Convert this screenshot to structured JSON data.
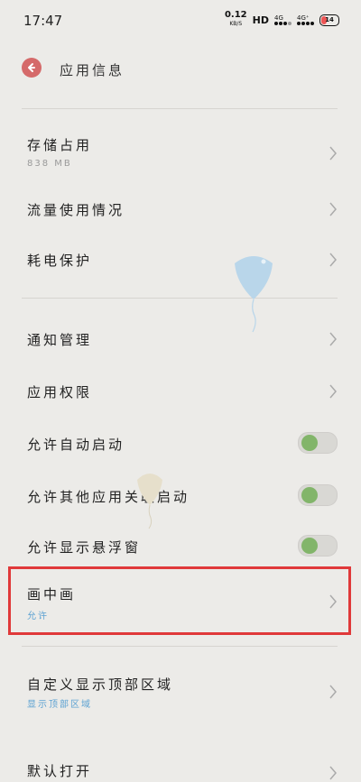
{
  "status": {
    "time": "17:47",
    "net_speed": "0.12",
    "net_unit": "KB/S",
    "hd": "HD",
    "sim1": "4G",
    "sim2": "4G⁺",
    "battery": "14"
  },
  "header": {
    "title": "应用信息"
  },
  "rows": {
    "storage": {
      "label": "存储占用",
      "sub": "838 MB"
    },
    "data_usage": {
      "label": "流量使用情况"
    },
    "battery_protect": {
      "label": "耗电保护"
    },
    "notifications": {
      "label": "通知管理"
    },
    "permissions": {
      "label": "应用权限"
    },
    "auto_start": {
      "label": "允许自动启动",
      "on": true
    },
    "assoc_start": {
      "label": "允许其他应用关联启动",
      "on": true
    },
    "floating": {
      "label": "允许显示悬浮窗",
      "on": true
    },
    "pip": {
      "label": "画中画",
      "sub": "允许"
    },
    "top_area": {
      "label": "自定义显示顶部区域",
      "sub": "显示顶部区域"
    },
    "default_open": {
      "label": "默认打开"
    }
  },
  "colors": {
    "background": "#ecebe8",
    "accent_blue": "#5da2d2",
    "toggle_on": "#82b56a",
    "highlight": "#e0393a",
    "back_button": "#d56a6a"
  },
  "icons": {
    "back": "back-arrow-icon",
    "chevron": "chevron-right-icon"
  }
}
